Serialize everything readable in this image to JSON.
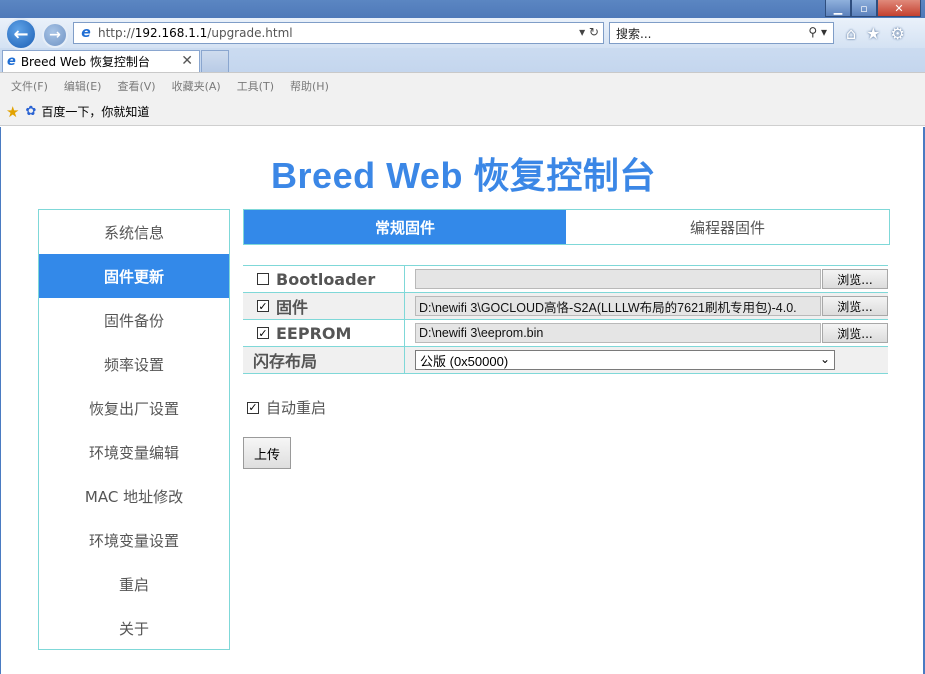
{
  "window": {
    "controls": {
      "minimize": "▁",
      "maximize": "▫",
      "close": "✕"
    }
  },
  "address_bar": {
    "url_prefix": "http://",
    "url_host": "192.168.1.1",
    "url_path": "/upgrade.html",
    "tools": "▾ ↻"
  },
  "search": {
    "placeholder": "搜索...",
    "tools": "⚲ ▾"
  },
  "browser_tab": {
    "title": "Breed Web 恢复控制台",
    "close": "✕"
  },
  "menu": [
    "文件(F)",
    "编辑(E)",
    "查看(V)",
    "收藏夹(A)",
    "工具(T)",
    "帮助(H)"
  ],
  "favorites": {
    "item": "百度一下，你就知道"
  },
  "page": {
    "title": "Breed Web 恢复控制台",
    "sidebar": [
      "系统信息",
      "固件更新",
      "固件备份",
      "频率设置",
      "恢复出厂设置",
      "环境变量编辑",
      "MAC 地址修改",
      "环境变量设置",
      "重启",
      "关于"
    ],
    "sidebar_active": "固件更新",
    "tabs": [
      "常规固件",
      "编程器固件"
    ],
    "rows": {
      "bootloader": {
        "label": "Bootloader",
        "checked": false,
        "path": "",
        "browse": "浏览..."
      },
      "firmware": {
        "label": "固件",
        "checked": true,
        "path": "D:\\newifi 3\\GOCLOUD高恪-S2A(LLLLW布局的7621刷机专用包)-4.0.",
        "browse": "浏览..."
      },
      "eeprom": {
        "label": "EEPROM",
        "checked": true,
        "path": "D:\\newifi 3\\eeprom.bin",
        "browse": "浏览..."
      },
      "flash_layout": {
        "label": "闪存布局",
        "selected": "公版 (0x50000)"
      }
    },
    "auto_reboot": {
      "label": "自动重启",
      "checked": true
    },
    "upload_button": "上传"
  },
  "colors": {
    "accent": "#3389e9",
    "border": "#7fd8d8",
    "title": "#3b87e6"
  }
}
